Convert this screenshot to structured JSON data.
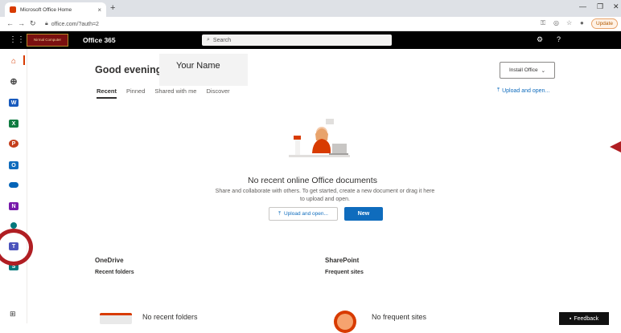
{
  "browser": {
    "tab_title": "Microsoft Office Home",
    "tab_close": "×",
    "new_tab": "+",
    "url": "office.com/?auth=2",
    "update_label": "Update",
    "window_controls": [
      "—",
      "❐",
      "✕"
    ]
  },
  "header": {
    "app_name": "Office 365",
    "logo_text": "Nirmal Computer",
    "search_placeholder": "Search",
    "settings_icon": "gear-icon",
    "help_label": "?"
  },
  "main": {
    "greeting": "Good evening,",
    "user_name": "Your Name",
    "install_label": "Install Office",
    "tabs": [
      {
        "label": "Recent",
        "active": true
      },
      {
        "label": "Pinned",
        "active": false
      },
      {
        "label": "Shared with me",
        "active": false
      },
      {
        "label": "Discover",
        "active": false
      }
    ],
    "upload_link": "Upload and open...",
    "empty_title": "No recent online Office documents",
    "empty_desc_1": "Share and collaborate with others. To get started, create a new document or drag it here",
    "empty_desc_2": "to upload and open.",
    "upload_button": "Upload and open...",
    "new_button": "New",
    "onedrive": {
      "title": "OneDrive",
      "subtitle": "Recent folders",
      "empty": "No recent folders"
    },
    "sharepoint": {
      "title": "SharePoint",
      "subtitle": "Frequent sites",
      "empty": "No frequent sites"
    },
    "feedback_label": "Feedback"
  },
  "rail": {
    "apps": [
      "home",
      "create",
      "outlook",
      "excel",
      "powerpoint",
      "outlook-mail",
      "onedrive",
      "onenote",
      "sharepoint",
      "teams",
      "sway"
    ],
    "colors": {
      "home": "#d83b01",
      "word": "#185abd",
      "excel": "#107c41",
      "powerpoint": "#c43e1c",
      "outlook": "#0f6cbd",
      "onedrive": "#0364b8",
      "onenote": "#7719aa",
      "sharepoint": "#03787c",
      "teams": "#4b53bc",
      "annotation": "#b01e23"
    }
  }
}
